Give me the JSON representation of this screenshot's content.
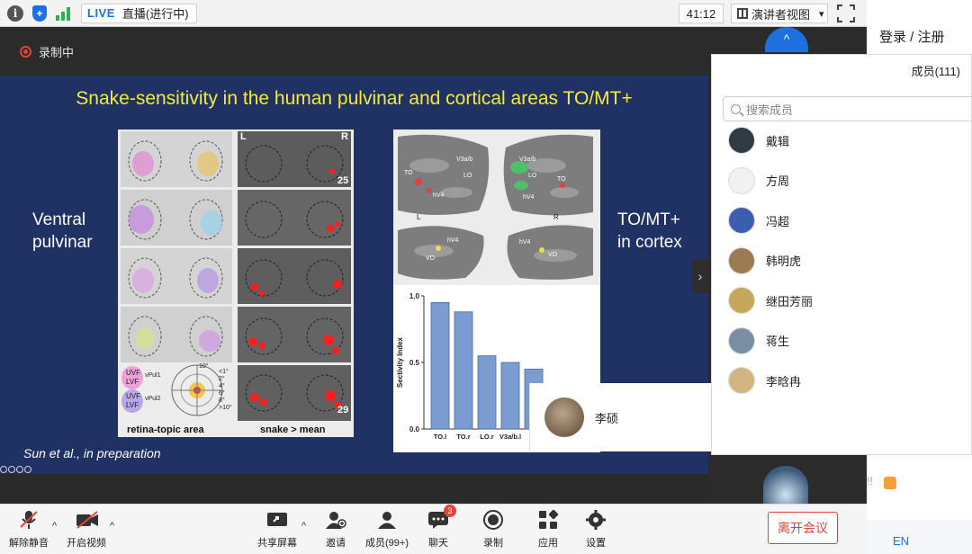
{
  "topbar": {
    "live_tag": "LIVE",
    "live_status": "直播(进行中)",
    "timer": "41:12",
    "view_mode": "演讲者视图",
    "view_caret": "▾"
  },
  "recording": {
    "label": "录制中"
  },
  "slide": {
    "title": "Snake-sensitivity in the human pulvinar and cortical areas TO/MT+",
    "left_label_line1": "Ventral",
    "left_label_line2": "pulvinar",
    "right_label_line1": "TO/MT+",
    "right_label_line2": "in cortex",
    "citation": "Sun et al., in preparation",
    "left_panel": {
      "header_left": "L",
      "header_right": "R",
      "numbers": [
        "25",
        "29"
      ],
      "legend_labels": [
        "UVF",
        "LVF",
        "UVF",
        "LVF"
      ],
      "legend_sublabels": [
        "vPul1",
        "vPul2"
      ],
      "degree_labels": [
        "<1°",
        "2°",
        "4°",
        "6°",
        "8°",
        ">10°"
      ],
      "degree_top": "10°",
      "footer_left": "retina-topic area",
      "footer_right": "snake > mean"
    },
    "brain_labels": {
      "top_left": [
        "V3a/b",
        "LO",
        "TO",
        "hV4"
      ],
      "top_right": [
        "V3a/b",
        "LO",
        "TO",
        "hV4"
      ],
      "hemi_left": "L",
      "hemi_right": "R",
      "bot_left": [
        "hV4",
        "VO"
      ],
      "bot_right": [
        "hV4",
        "VO"
      ]
    }
  },
  "chart_data": {
    "type": "bar",
    "categories": [
      "TO.l",
      "TO.r",
      "LO.r",
      "V3a/b.l",
      "V"
    ],
    "values": [
      0.95,
      0.88,
      0.55,
      0.5,
      0.45
    ],
    "ylabel": "Sectivity Index",
    "ylim": [
      0,
      1.0
    ],
    "yticks": [
      "1.0",
      "0.5",
      "0.0"
    ],
    "bar_color": "#7b9cd0"
  },
  "floating": {
    "chevron": "‹"
  },
  "side_expand": {
    "chevron": "›"
  },
  "video_tile": {
    "name": "李硕"
  },
  "member_panel": {
    "title": "成员(111)",
    "search_placeholder": "搜索成员",
    "members": [
      {
        "name": "戴辑",
        "color": "#2f3a45"
      },
      {
        "name": "方周",
        "color": "#f1f1f1"
      },
      {
        "name": "冯超",
        "color": "#3a5fb0"
      },
      {
        "name": "韩明虎",
        "color": "#9c7a52"
      },
      {
        "name": "继田芳丽",
        "color": "#c7a85a"
      },
      {
        "name": "蒋生",
        "color": "#7a8fa6"
      },
      {
        "name": "李晗冉",
        "color": "#d4b483"
      }
    ]
  },
  "right_strip": {
    "login": "登录 / 注册",
    "en": "EN",
    "up_chevron": "^",
    "like_text": "!!"
  },
  "toolbar": {
    "mute": "解除静音",
    "video": "开启视频",
    "share": "共享屏幕",
    "invite": "邀请",
    "members": "成员(99+)",
    "chat": "聊天",
    "chat_badge": "3",
    "record": "录制",
    "apps": "应用",
    "settings": "设置",
    "leave": "离开会议",
    "caret": "^"
  },
  "colors": {
    "slide_bg": "#1f3263",
    "title_yellow": "#f5ea3a",
    "accent_blue": "#1e6fe0",
    "leave_red": "#e0443b"
  }
}
